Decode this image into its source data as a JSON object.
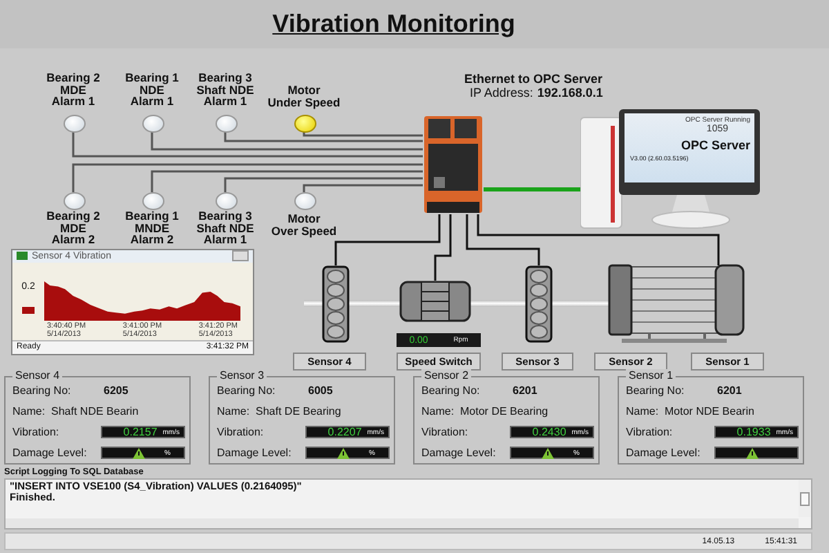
{
  "title": "Vibration Monitoring",
  "alarms_top": [
    {
      "label": "Bearing 2\nMDE\nAlarm 1",
      "on": false
    },
    {
      "label": "Bearing 1\nNDE\nAlarm 1",
      "on": false
    },
    {
      "label": "Bearing 3\nShaft NDE\nAlarm 1",
      "on": false
    },
    {
      "label": "Motor\nUnder Speed",
      "on": true
    }
  ],
  "alarms_bottom": [
    {
      "label": "Bearing 2\nMDE\nAlarm 2",
      "on": false
    },
    {
      "label": "Bearing 1\nMNDE\nAlarm 2",
      "on": false
    },
    {
      "label": "Bearing 3\nShaft NDE\nAlarm 1",
      "on": false
    },
    {
      "label": "Motor\nOver Speed",
      "on": false
    }
  ],
  "ethernet": {
    "label": "Ethernet to OPC Server",
    "ip_label": "IP Address:",
    "ip": "192.168.0.1"
  },
  "opc_screen": {
    "status": "OPC Server Running",
    "count": "1059",
    "name": "OPC Server",
    "version": "V3.00 (2.60.03.5196)"
  },
  "trend_window": {
    "title": "Sensor 4 Vibration",
    "ytick": "0.2",
    "times": [
      {
        "time": "3:40:40 PM",
        "date": "5/14/2013"
      },
      {
        "time": "3:41:00 PM",
        "date": "5/14/2013"
      },
      {
        "time": "3:41:20 PM",
        "date": "5/14/2013"
      }
    ],
    "status": "Ready",
    "clock": "3:41:32 PM"
  },
  "machine": {
    "rpm": "0.00",
    "rpm_unit": "Rpm",
    "labels": [
      "Sensor 4",
      "Speed Switch",
      "Sensor 3",
      "Sensor 2",
      "Sensor 1"
    ]
  },
  "sensors": [
    {
      "title": "Sensor 4",
      "bearing_label": "Bearing No:",
      "bearing_no": "6205",
      "name_label": "Name:",
      "name": "Shaft NDE Bearin",
      "vibration_label": "Vibration:",
      "vibration": "0.2157",
      "vibration_unit": "mm/s",
      "damage_label": "Damage Level:",
      "damage_unit": "%"
    },
    {
      "title": "Sensor 3",
      "bearing_label": "Bearing No:",
      "bearing_no": "6005",
      "name_label": "Name:",
      "name": "Shaft DE Bearing",
      "vibration_label": "Vibration:",
      "vibration": "0.2207",
      "vibration_unit": "mm/s",
      "damage_label": "Damage Level:",
      "damage_unit": "%"
    },
    {
      "title": "Sensor 2",
      "bearing_label": "Bearing No:",
      "bearing_no": "6201",
      "name_label": "Name:",
      "name": "Motor DE Bearing",
      "vibration_label": "Vibration:",
      "vibration": "0.2430",
      "vibration_unit": "mm/s",
      "damage_label": "Damage Level:",
      "damage_unit": "%"
    },
    {
      "title": "Sensor 1",
      "bearing_label": "Bearing No:",
      "bearing_no": "6201",
      "name_label": "Name:",
      "name": "Motor NDE Bearin",
      "vibration_label": "Vibration:",
      "vibration": "0.1933",
      "vibration_unit": "mm/s",
      "damage_label": "Damage Level:"
    }
  ],
  "log": {
    "title": "Script Logging To SQL Database",
    "lines": [
      "\"INSERT INTO VSE100 (S4_Vibration) VALUES (0.2164095)\"",
      "Finished."
    ],
    "date": "14.05.13",
    "time": "15:41:31"
  }
}
